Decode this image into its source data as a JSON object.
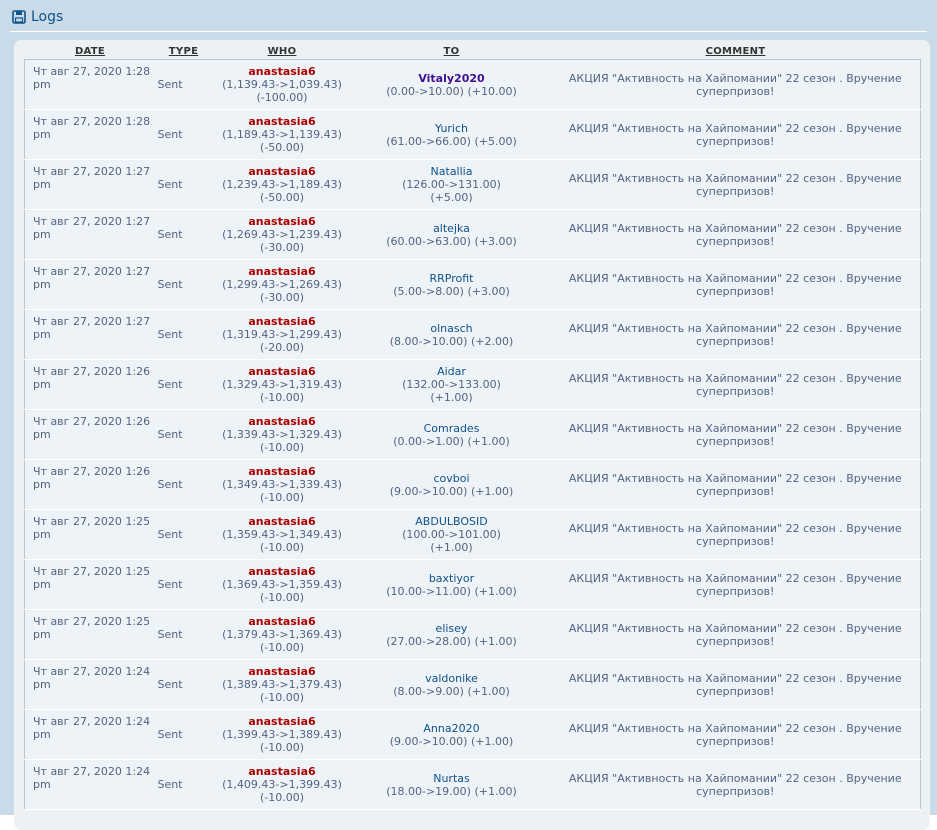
{
  "header": {
    "title": "Logs",
    "icon": "save-icon"
  },
  "columns": {
    "date": "DATE",
    "type": "TYPE",
    "who": "WHO",
    "to": "TO",
    "comment": "COMMENT"
  },
  "rows": [
    {
      "date": "Чт авг 27, 2020 1:28 pm",
      "type": "Sent",
      "who_name": "anastasia6",
      "who_balance": "(1,139.43->1,039.43)",
      "who_delta": "(-100.00)",
      "to_name": "Vitaly2020",
      "to_detail": "(0.00->10.00) (+10.00)",
      "to_extra": "",
      "comment": "АКЦИЯ \"Активность на Хайпомании\" 22 сезон . Вручение суперпризов!"
    },
    {
      "date": "Чт авг 27, 2020 1:28 pm",
      "type": "Sent",
      "who_name": "anastasia6",
      "who_balance": "(1,189.43->1,139.43)",
      "who_delta": "(-50.00)",
      "to_name": "Yurich",
      "to_detail": "(61.00->66.00) (+5.00)",
      "to_extra": "",
      "comment": "АКЦИЯ \"Активность на Хайпомании\" 22 сезон . Вручение суперпризов!"
    },
    {
      "date": "Чт авг 27, 2020 1:27 pm",
      "type": "Sent",
      "who_name": "anastasia6",
      "who_balance": "(1,239.43->1,189.43)",
      "who_delta": "(-50.00)",
      "to_name": "Natallia",
      "to_detail": "(126.00->131.00)",
      "to_extra": "(+5.00)",
      "comment": "АКЦИЯ \"Активность на Хайпомании\" 22 сезон . Вручение суперпризов!"
    },
    {
      "date": "Чт авг 27, 2020 1:27 pm",
      "type": "Sent",
      "who_name": "anastasia6",
      "who_balance": "(1,269.43->1,239.43)",
      "who_delta": "(-30.00)",
      "to_name": "altejka",
      "to_detail": "(60.00->63.00) (+3.00)",
      "to_extra": "",
      "comment": "АКЦИЯ \"Активность на Хайпомании\" 22 сезон . Вручение суперпризов!"
    },
    {
      "date": "Чт авг 27, 2020 1:27 pm",
      "type": "Sent",
      "who_name": "anastasia6",
      "who_balance": "(1,299.43->1,269.43)",
      "who_delta": "(-30.00)",
      "to_name": "RRProfit",
      "to_detail": "(5.00->8.00) (+3.00)",
      "to_extra": "",
      "comment": "АКЦИЯ \"Активность на Хайпомании\" 22 сезон . Вручение суперпризов!"
    },
    {
      "date": "Чт авг 27, 2020 1:27 pm",
      "type": "Sent",
      "who_name": "anastasia6",
      "who_balance": "(1,319.43->1,299.43)",
      "who_delta": "(-20.00)",
      "to_name": "olnasch",
      "to_detail": "(8.00->10.00) (+2.00)",
      "to_extra": "",
      "comment": "АКЦИЯ \"Активность на Хайпомании\" 22 сезон . Вручение суперпризов!"
    },
    {
      "date": "Чт авг 27, 2020 1:26 pm",
      "type": "Sent",
      "who_name": "anastasia6",
      "who_balance": "(1,329.43->1,319.43)",
      "who_delta": "(-10.00)",
      "to_name": "Aidar",
      "to_detail": "(132.00->133.00)",
      "to_extra": "(+1.00)",
      "comment": "АКЦИЯ \"Активность на Хайпомании\" 22 сезон . Вручение суперпризов!"
    },
    {
      "date": "Чт авг 27, 2020 1:26 pm",
      "type": "Sent",
      "who_name": "anastasia6",
      "who_balance": "(1,339.43->1,329.43)",
      "who_delta": "(-10.00)",
      "to_name": "Comrades",
      "to_detail": "(0.00->1.00) (+1.00)",
      "to_extra": "",
      "comment": "АКЦИЯ \"Активность на Хайпомании\" 22 сезон . Вручение суперпризов!"
    },
    {
      "date": "Чт авг 27, 2020 1:26 pm",
      "type": "Sent",
      "who_name": "anastasia6",
      "who_balance": "(1,349.43->1,339.43)",
      "who_delta": "(-10.00)",
      "to_name": "covboi",
      "to_detail": "(9.00->10.00) (+1.00)",
      "to_extra": "",
      "comment": "АКЦИЯ \"Активность на Хайпомании\" 22 сезон . Вручение суперпризов!"
    },
    {
      "date": "Чт авг 27, 2020 1:25 pm",
      "type": "Sent",
      "who_name": "anastasia6",
      "who_balance": "(1,359.43->1,349.43)",
      "who_delta": "(-10.00)",
      "to_name": "ABDULBOSID",
      "to_detail": "(100.00->101.00)",
      "to_extra": "(+1.00)",
      "comment": "АКЦИЯ \"Активность на Хайпомании\" 22 сезон . Вручение суперпризов!"
    },
    {
      "date": "Чт авг 27, 2020 1:25 pm",
      "type": "Sent",
      "who_name": "anastasia6",
      "who_balance": "(1,369.43->1,359.43)",
      "who_delta": "(-10.00)",
      "to_name": "baxtiyor",
      "to_detail": "(10.00->11.00) (+1.00)",
      "to_extra": "",
      "comment": "АКЦИЯ \"Активность на Хайпомании\" 22 сезон . Вручение суперпризов!"
    },
    {
      "date": "Чт авг 27, 2020 1:25 pm",
      "type": "Sent",
      "who_name": "anastasia6",
      "who_balance": "(1,379.43->1,369.43)",
      "who_delta": "(-10.00)",
      "to_name": "elisey",
      "to_detail": "(27.00->28.00) (+1.00)",
      "to_extra": "",
      "comment": "АКЦИЯ \"Активность на Хайпомании\" 22 сезон . Вручение суперпризов!"
    },
    {
      "date": "Чт авг 27, 2020 1:24 pm",
      "type": "Sent",
      "who_name": "anastasia6",
      "who_balance": "(1,389.43->1,379.43)",
      "who_delta": "(-10.00)",
      "to_name": "valdonike",
      "to_detail": "(8.00->9.00) (+1.00)",
      "to_extra": "",
      "comment": "АКЦИЯ \"Активность на Хайпомании\" 22 сезон . Вручение суперпризов!"
    },
    {
      "date": "Чт авг 27, 2020 1:24 pm",
      "type": "Sent",
      "who_name": "anastasia6",
      "who_balance": "(1,399.43->1,389.43)",
      "who_delta": "(-10.00)",
      "to_name": "Anna2020",
      "to_detail": "(9.00->10.00) (+1.00)",
      "to_extra": "",
      "comment": "АКЦИЯ \"Активность на Хайпомании\" 22 сезон . Вручение суперпризов!"
    },
    {
      "date": "Чт авг 27, 2020 1:24 pm",
      "type": "Sent",
      "who_name": "anastasia6",
      "who_balance": "(1,409.43->1,399.43)",
      "who_delta": "(-10.00)",
      "to_name": "Nurtas",
      "to_detail": "(18.00->19.00) (+1.00)",
      "to_extra": "",
      "comment": "АКЦИЯ \"Активность на Хайпомании\" 22 сезон . Вручение суперпризов!"
    }
  ]
}
